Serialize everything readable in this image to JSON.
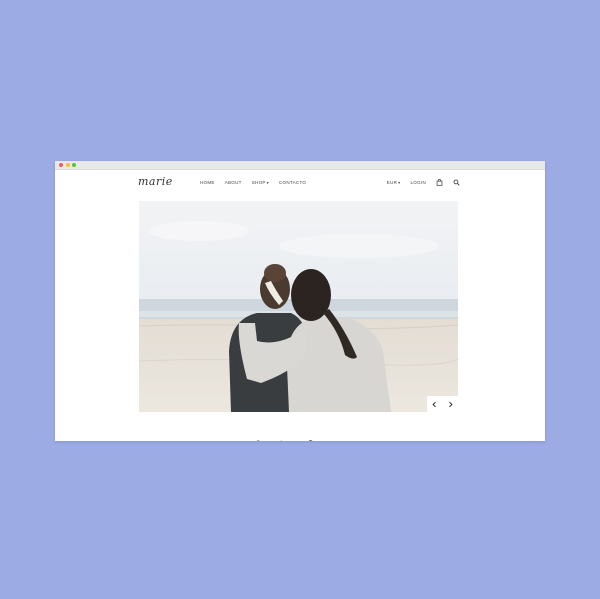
{
  "colors": {
    "page_background": "#9cabe4",
    "window_background": "#ffffff",
    "traffic_red": "#ef5d58",
    "traffic_yellow": "#f4bd3b",
    "traffic_green": "#52c33f"
  },
  "brand": {
    "logo_text": "marie"
  },
  "nav": {
    "items": [
      {
        "label": "HOME"
      },
      {
        "label": "ABOUT"
      },
      {
        "label": "SHOP",
        "has_dropdown": true
      },
      {
        "label": "CONTACTO"
      }
    ],
    "currency": "EUR",
    "login_label": "LOGIN",
    "icons": [
      "shopping-bag-icon",
      "search-icon"
    ]
  },
  "hero": {
    "image": "beach-couple-photo",
    "controls": [
      "chevron-left-icon",
      "chevron-right-icon"
    ]
  }
}
